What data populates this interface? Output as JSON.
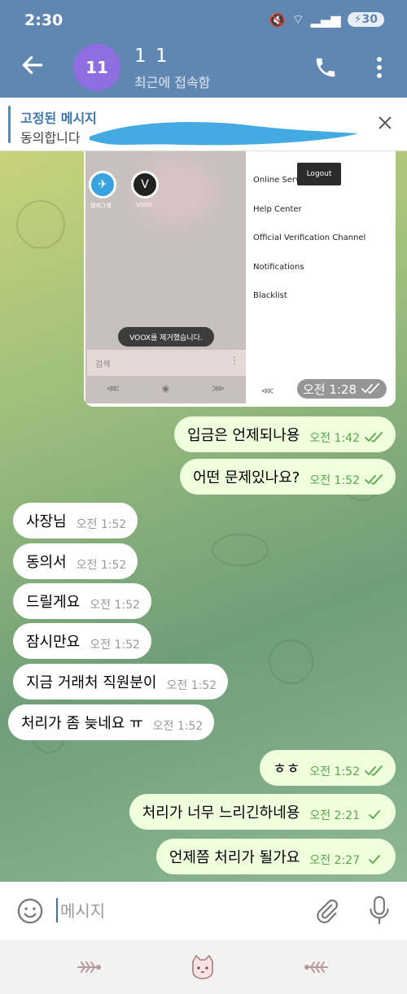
{
  "status": {
    "time": "2:30",
    "battery": "30"
  },
  "header": {
    "avatar_text": "11",
    "title": "1 1",
    "subtitle": "최근에 접속함"
  },
  "pinned": {
    "title": "고정된 메시지",
    "text": "동의합니다"
  },
  "screenshot": {
    "apps": [
      {
        "label": "텔레그램"
      },
      {
        "label": "VOOX"
      }
    ],
    "toast": "VOOX를 제거했습니다.",
    "search": "검색",
    "menu": [
      "Online Serv",
      "Help Center",
      "Official Verification Channel",
      "Notifications",
      "Blacklist"
    ],
    "logout": "Logout",
    "time": "오전 1:28"
  },
  "messages": [
    {
      "dir": "out",
      "text": "입금은 언제되나용",
      "time": "오전 1:42",
      "status": "read"
    },
    {
      "dir": "out",
      "text": "어떤 문제있나요?",
      "time": "오전 1:52",
      "status": "read"
    },
    {
      "dir": "in",
      "text": "사장님",
      "time": "오전 1:52"
    },
    {
      "dir": "in",
      "text": "동의서",
      "time": "오전 1:52"
    },
    {
      "dir": "in",
      "text": "드릴게요",
      "time": "오전 1:52"
    },
    {
      "dir": "in",
      "text": "잠시만요",
      "time": "오전 1:52"
    },
    {
      "dir": "in",
      "text": "지금 거래처 직원분이",
      "time": "오전 1:52"
    },
    {
      "dir": "in",
      "text": "처리가 좀 늦네요 ㅠ",
      "time": "오전 1:52"
    },
    {
      "dir": "out",
      "text": "ㅎㅎ",
      "time": "오전 1:52",
      "status": "read"
    },
    {
      "dir": "out",
      "text": "처리가 너무 느리긴하네용",
      "time": "오전 2:21",
      "status": "sent"
    },
    {
      "dir": "out",
      "text": "언제쯤 처리가 될가요",
      "time": "오전 2:27",
      "status": "sent"
    }
  ],
  "input": {
    "placeholder": "메시지"
  },
  "colors": {
    "header": "#5f87b1",
    "outgoing_bubble": "#effedd",
    "incoming_bubble": "#ffffff",
    "check": "#5aa84a"
  }
}
